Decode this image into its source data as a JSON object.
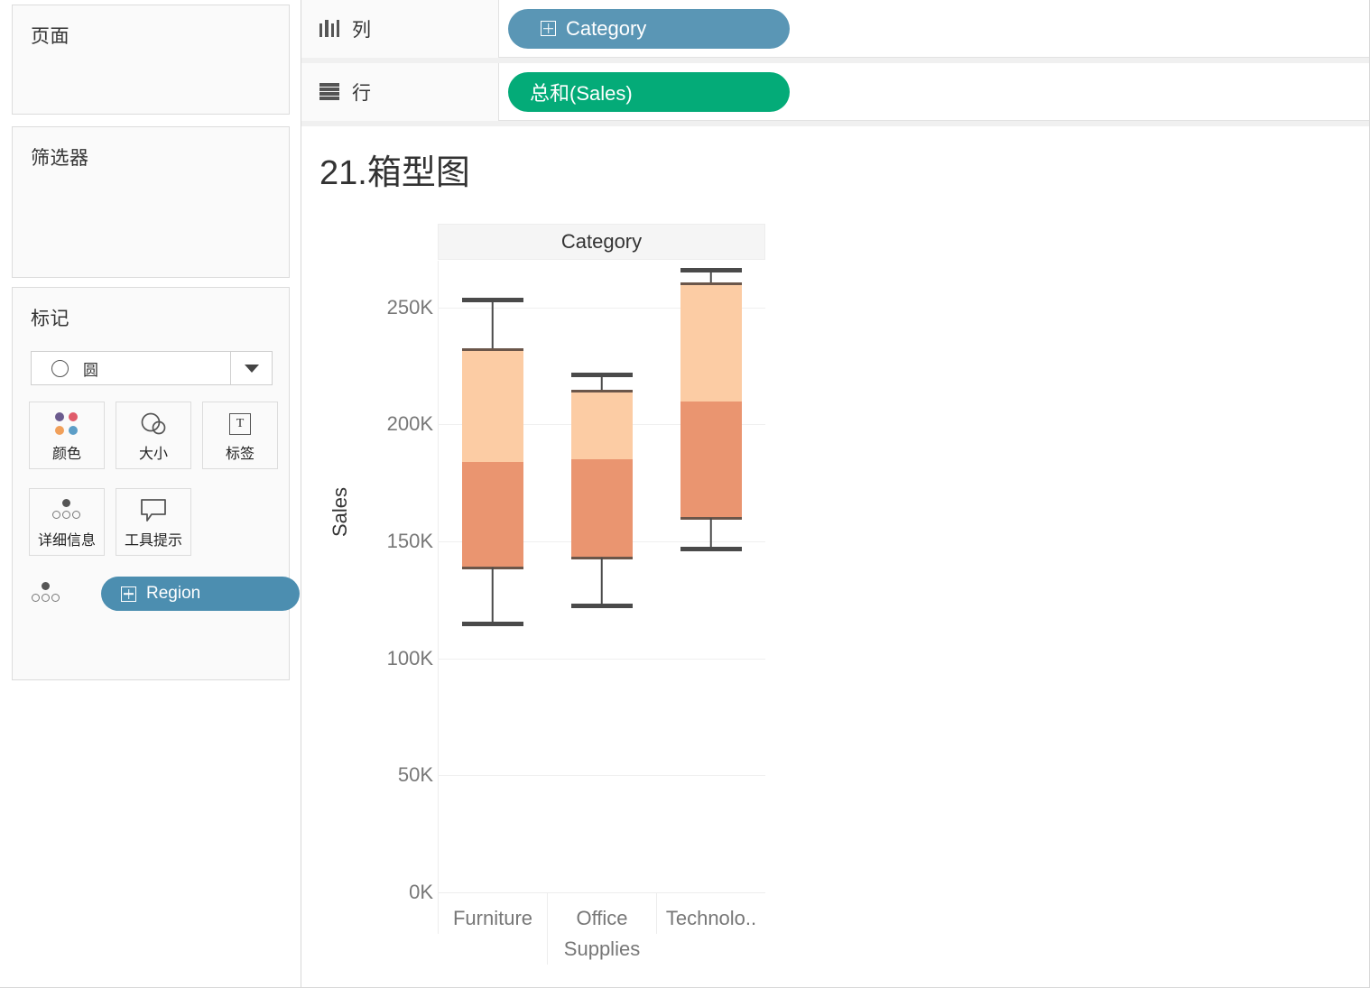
{
  "left_panel": {
    "pages_card": {
      "title": "页面"
    },
    "filters_card": {
      "title": "筛选器"
    },
    "marks_card": {
      "title": "标记",
      "mark_type": "圆",
      "dropdown_icon": "chevron-down-icon",
      "buttons": [
        {
          "label": "颜色",
          "icon": "color-dots-icon"
        },
        {
          "label": "大小",
          "icon": "size-circles-icon"
        },
        {
          "label": "标签",
          "icon": "text-label-icon"
        },
        {
          "label": "详细信息",
          "icon": "detail-dots-icon"
        },
        {
          "label": "工具提示",
          "icon": "tooltip-bubble-icon"
        }
      ],
      "detail_pill": {
        "label": "Region",
        "icon": "dimension-grid-icon",
        "color": "#4c8eb0"
      }
    }
  },
  "shelves": [
    {
      "name": "列",
      "icon": "columns-icon",
      "pill": {
        "label": "Category",
        "icon": "dimension-grid-icon",
        "color": "#5a96b5"
      }
    },
    {
      "name": "行",
      "icon": "rows-icon",
      "pill": {
        "label": "总和(Sales)",
        "color": "#04ab78"
      }
    }
  ],
  "viz": {
    "title": "21.箱型图",
    "column_header": "Category",
    "y_axis_title": "Sales"
  },
  "chart_data": {
    "type": "box",
    "title": "21.箱型图",
    "xlabel": "Category",
    "ylabel": "Sales",
    "ylim": [
      0,
      270000
    ],
    "yticks": [
      0,
      50000,
      100000,
      150000,
      200000,
      250000
    ],
    "ytick_labels": [
      "0K",
      "50K",
      "100K",
      "150K",
      "200K",
      "250K"
    ],
    "grid": true,
    "legend": "none",
    "colors": {
      "upper_box": "#fccca4",
      "lower_box": "#ea9570",
      "whisker": "#4a4a4a",
      "box_edge": "#6b564a"
    },
    "categories": [
      "Furniture",
      "Office Supplies",
      "Technology"
    ],
    "category_tick_labels": [
      "Furniture",
      "Office Supplies",
      "Technolo.."
    ],
    "boxes": [
      {
        "category": "Furniture",
        "whisker_high": 254000,
        "q3": 232000,
        "median": 184000,
        "q1": 139000,
        "whisker_low": 114000
      },
      {
        "category": "Office Supplies",
        "whisker_high": 222000,
        "q3": 214000,
        "median": 185000,
        "q1": 143000,
        "whisker_low": 122000
      },
      {
        "category": "Technology",
        "whisker_high": 267000,
        "q3": 260000,
        "median": 210000,
        "q1": 160000,
        "whisker_low": 146000
      }
    ]
  }
}
